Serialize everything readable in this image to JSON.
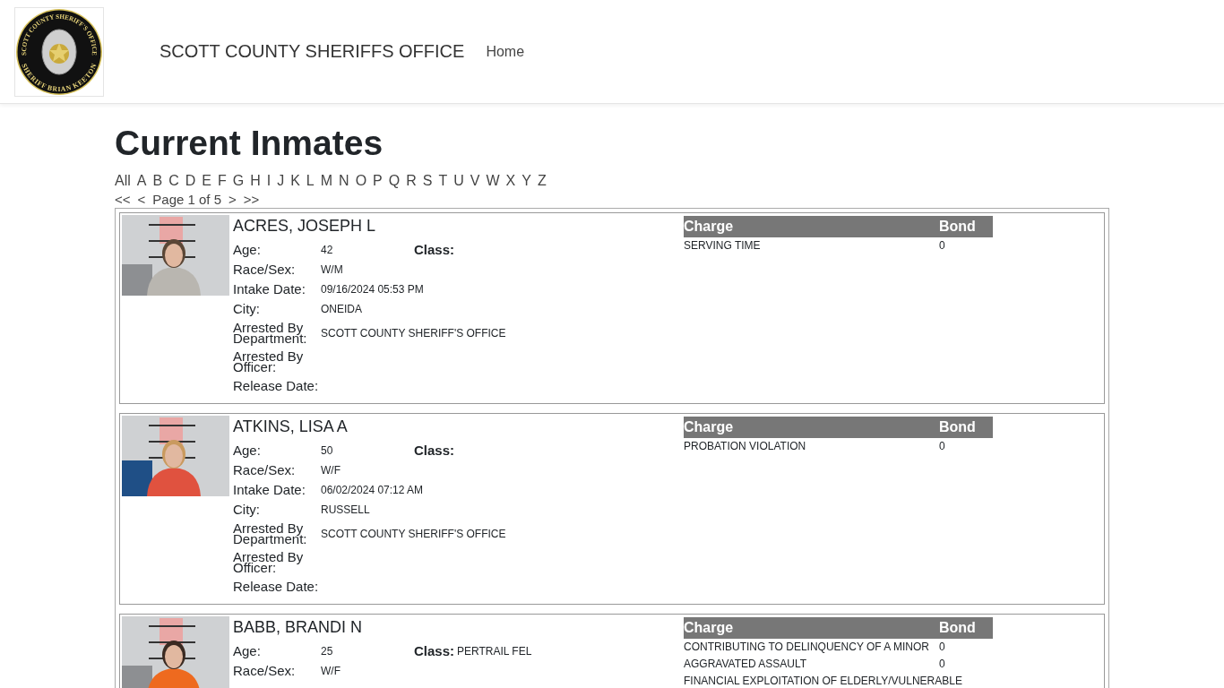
{
  "logo": {
    "top_text": "SCOTT COUNTY SHERIFF'S OFFICE",
    "bottom_text": "SHERIFF BRIAN KEETON"
  },
  "site_title": "SCOTT COUNTY SHERIFFS OFFICE",
  "nav": [
    {
      "label": "Home"
    }
  ],
  "page_title": "Current Inmates",
  "letters": [
    "All",
    "A",
    "B",
    "C",
    "D",
    "E",
    "F",
    "G",
    "H",
    "I",
    "J",
    "K",
    "L",
    "M",
    "N",
    "O",
    "P",
    "Q",
    "R",
    "S",
    "T",
    "U",
    "V",
    "W",
    "X",
    "Y",
    "Z"
  ],
  "pager": {
    "first": "<<",
    "prev": "<",
    "label": "Page 1 of 5",
    "next": ">",
    "last": ">>"
  },
  "inmates": [
    {
      "name": "ACRES, JOSEPH L",
      "photo": {
        "kind": "picture"
      },
      "age_label": "Age:",
      "age": "42",
      "class_label": "Class:",
      "details": [
        {
          "label": "Race/Sex:",
          "value": "W/M"
        },
        {
          "label": "Intake Date:",
          "value": "09/16/2024 05:53 PM"
        },
        {
          "label": "City:",
          "value": "ONEIDA"
        },
        {
          "label": "Arrested By Department:",
          "value": "SCOTT COUNTY SHERIFF'S OFFICE"
        },
        {
          "label": "Arrested By Officer:"
        },
        {
          "label": "Release Date:"
        }
      ],
      "charge_columns": [
        "Charge",
        "Bond"
      ],
      "charges": [
        {
          "charge": "SERVING TIME",
          "bond": "0"
        }
      ]
    },
    {
      "name": "ATKINS, LISA A",
      "photo": {
        "kind": "picture"
      },
      "age_label": "Age:",
      "age": "50",
      "class_label": "Class:",
      "details": [
        {
          "label": "Race/Sex:",
          "value": "W/F"
        },
        {
          "label": "Intake Date:",
          "value": "06/02/2024 07:12 AM"
        },
        {
          "label": "City:",
          "value": "RUSSELL"
        },
        {
          "label": "Arrested By Department:",
          "value": "SCOTT COUNTY SHERIFF'S OFFICE"
        },
        {
          "label": "Arrested By Officer:"
        },
        {
          "label": "Release Date:"
        }
      ],
      "charge_columns": [
        "Charge",
        "Bond"
      ],
      "charges": [
        {
          "charge": "PROBATION VIOLATION",
          "bond": "0"
        }
      ]
    },
    {
      "name": "BABB, BRANDI N",
      "photo": {
        "kind": "picture"
      },
      "age_label": "Age:",
      "age": "25",
      "class_label": "Class:",
      "class": "PERTRAIL FEL",
      "details": [
        {
          "label": "Race/Sex:",
          "value": "W/F"
        }
      ],
      "charge_columns": [
        "Charge",
        "Bond"
      ],
      "charges": [
        {
          "charge": "CONTRIBUTING TO DELINQUENCY OF A MINOR",
          "bond": "0"
        },
        {
          "charge": "AGGRAVATED ASSAULT",
          "bond": "0"
        },
        {
          "charge": "FINANCIAL EXPLOITATION OF ELDERLY/VULNERABLE"
        }
      ]
    }
  ]
}
